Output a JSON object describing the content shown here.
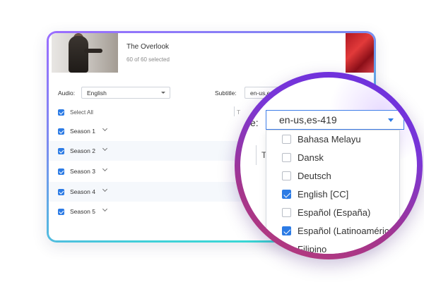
{
  "movie": {
    "title": "The Overlook",
    "selected": "60 of 60 selected"
  },
  "options": {
    "audio_label": "Audio:",
    "audio_value": "English",
    "subtitle_label": "Subtitle:",
    "subtitle_value": "en-us,es",
    "column_hint": "T"
  },
  "episodes": {
    "select_all": "Select All",
    "seasons": [
      {
        "label": "Season 1"
      },
      {
        "label": "Season 2"
      },
      {
        "label": "Season 3"
      },
      {
        "label": "Season 4"
      },
      {
        "label": "Season 5"
      }
    ]
  },
  "magnifier": {
    "label": "e:",
    "subtitle_value": "en-us,es-419",
    "under_text": "T",
    "languages": [
      {
        "label": "Bahasa Melayu",
        "checked": false
      },
      {
        "label": "Dansk",
        "checked": false
      },
      {
        "label": "Deutsch",
        "checked": false
      },
      {
        "label": "English [CC]",
        "checked": true
      },
      {
        "label": "Español (España)",
        "checked": false
      },
      {
        "label": "Español (Latinoaméric",
        "checked": true
      },
      {
        "label": "Filipino",
        "checked": false
      }
    ]
  },
  "colors": {
    "accent": "#2c7be5",
    "ring_top": "#6a2fe0",
    "ring_bottom": "#b83a78",
    "border_top": "#9b6cff",
    "border_bottom": "#33e0d0"
  },
  "icons": [
    "checkbox-checked-icon",
    "chevron-down-icon",
    "caret-down-icon"
  ]
}
